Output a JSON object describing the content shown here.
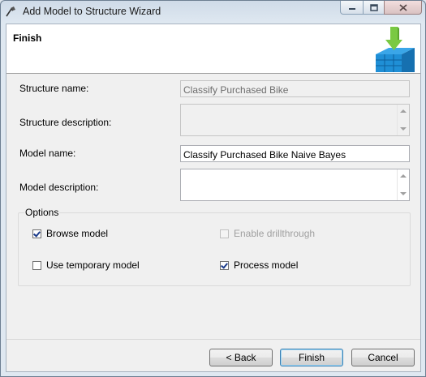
{
  "window": {
    "title": "Add Model to Structure Wizard",
    "controls": [
      "minimize-icon",
      "maximize-icon",
      "close-icon"
    ]
  },
  "header": {
    "title": "Finish",
    "graphic_icon": "mining-structure-arrow-icon"
  },
  "form": {
    "structure_name_label": "Structure name:",
    "structure_name_value": "Classify Purchased Bike",
    "structure_description_label": "Structure description:",
    "structure_description_value": "",
    "model_name_label": "Model name:",
    "model_name_value": "Classify Purchased Bike Naive Bayes",
    "model_description_label": "Model description:",
    "model_description_value": ""
  },
  "options": {
    "title": "Options",
    "browse_model": {
      "label": "Browse model",
      "checked": true,
      "enabled": true
    },
    "enable_drillthrough": {
      "label": "Enable drillthrough",
      "checked": false,
      "enabled": false
    },
    "use_temporary_model": {
      "label": "Use temporary model",
      "checked": false,
      "enabled": true
    },
    "process_model": {
      "label": "Process model",
      "checked": true,
      "enabled": true
    }
  },
  "buttons": {
    "back": "< Back",
    "finish": "Finish",
    "cancel": "Cancel"
  },
  "colors": {
    "header_bg": "#ffffff",
    "dialog_bg": "#f0f0f0",
    "accent_green": "#7ac943",
    "accent_blue": "#1f8fd6"
  }
}
